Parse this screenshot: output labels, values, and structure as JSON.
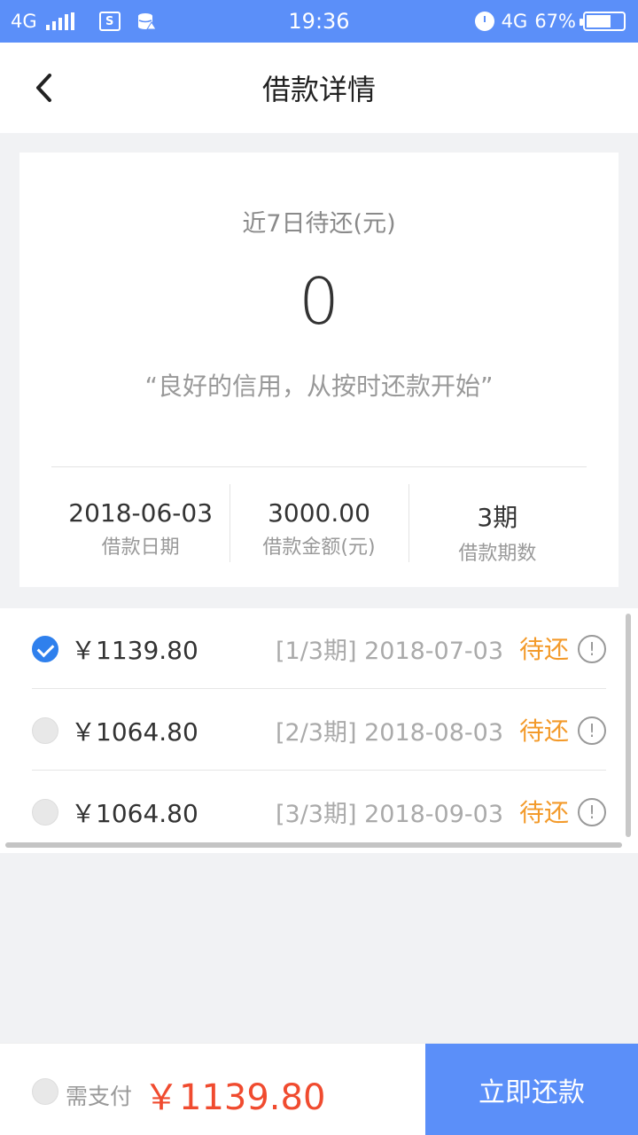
{
  "status_bar": {
    "network": "4G",
    "time": "19:36",
    "network_right": "4G",
    "battery": "67%",
    "battery_level": 0.67,
    "icons": [
      "signal-icon",
      "s-box-icon",
      "database-icon",
      "alarm-icon",
      "battery-icon"
    ]
  },
  "header": {
    "title": "借款详情",
    "back_icon": "chevron-left-icon"
  },
  "summary": {
    "label": "近7日待还(元)",
    "value": "0",
    "slogan": "“良好的信用，从按时还款开始”",
    "stats": [
      {
        "value": "2018-06-03",
        "label": "借款日期"
      },
      {
        "value": "3000.00",
        "label": "借款金额(元)"
      },
      {
        "value": "3期",
        "label": "借款期数"
      }
    ]
  },
  "installments": [
    {
      "selected": true,
      "amount": "￥1139.80",
      "period": "[1/3期] 2018-07-03",
      "status": "待还",
      "info_icon": "!"
    },
    {
      "selected": false,
      "amount": "￥1064.80",
      "period": "[2/3期] 2018-08-03",
      "status": "待还",
      "info_icon": "!"
    },
    {
      "selected": false,
      "amount": "￥1064.80",
      "period": "[3/3期] 2018-09-03",
      "status": "待还",
      "info_icon": "!"
    }
  ],
  "bottom": {
    "label": "需支付",
    "total": "￥1139.80",
    "pay_button": "立即还款"
  },
  "colors": {
    "accent": "#5b8ff9",
    "pending": "#f39a2a",
    "total": "#f04b2f",
    "check": "#2f80ed"
  }
}
